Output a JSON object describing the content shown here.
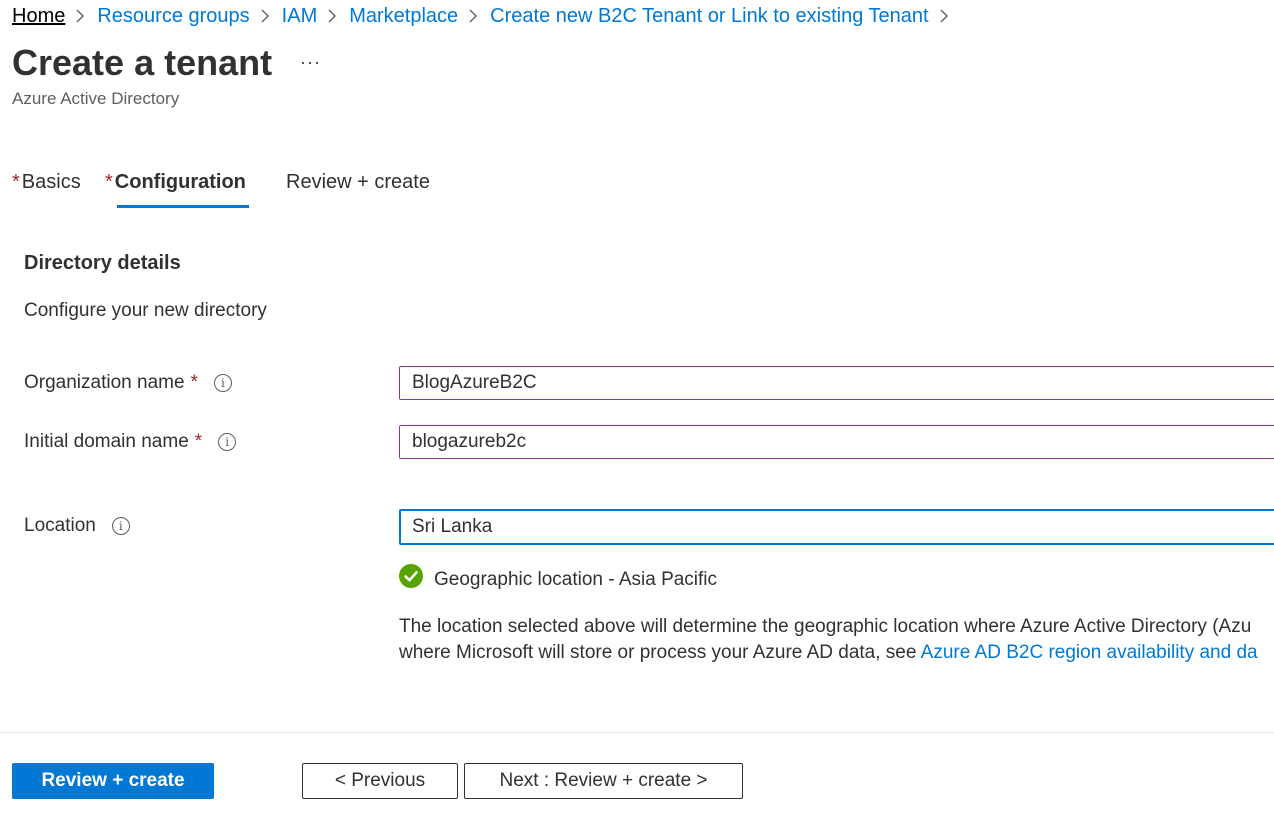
{
  "breadcrumb": {
    "items": [
      "Home",
      "Resource groups",
      "IAM",
      "Marketplace",
      "Create new B2C Tenant or Link to existing Tenant"
    ]
  },
  "header": {
    "title": "Create a tenant",
    "more": "···",
    "subtitle": "Azure Active Directory"
  },
  "tabs": [
    {
      "label": "Basics",
      "required": "*"
    },
    {
      "label": "Configuration",
      "required": "*",
      "active": true
    },
    {
      "label": "Review + create"
    }
  ],
  "section": {
    "title": "Directory details",
    "description": "Configure your new directory"
  },
  "fields": {
    "org_name": {
      "label": "Organization name",
      "required": "*",
      "value": "BlogAzureB2C"
    },
    "domain_name": {
      "label": "Initial domain name",
      "required": "*",
      "value": "blogazureb2c"
    },
    "location": {
      "label": "Location",
      "value": "Sri Lanka"
    }
  },
  "validation": {
    "text": "Geographic location - Asia Pacific"
  },
  "location_note": {
    "line1": "The location selected above will determine the geographic location where Azure Active Directory (Azu",
    "line2": "where Microsoft will store or process your Azure AD data, see ",
    "link": "Azure AD B2C region availability and da"
  },
  "footer": {
    "review_create": "Review + create",
    "previous": "< Previous",
    "next": "Next : Review + create >"
  },
  "colors": {
    "accent": "#0078d4",
    "required": "#a4262c",
    "success": "#57a300",
    "input_border": "#8a3c8c"
  },
  "icons": {
    "breadcrumb_separator": "chevron-right-icon",
    "info": "info-icon",
    "validation": "checkmark-circle-icon",
    "more": "more-icon"
  }
}
